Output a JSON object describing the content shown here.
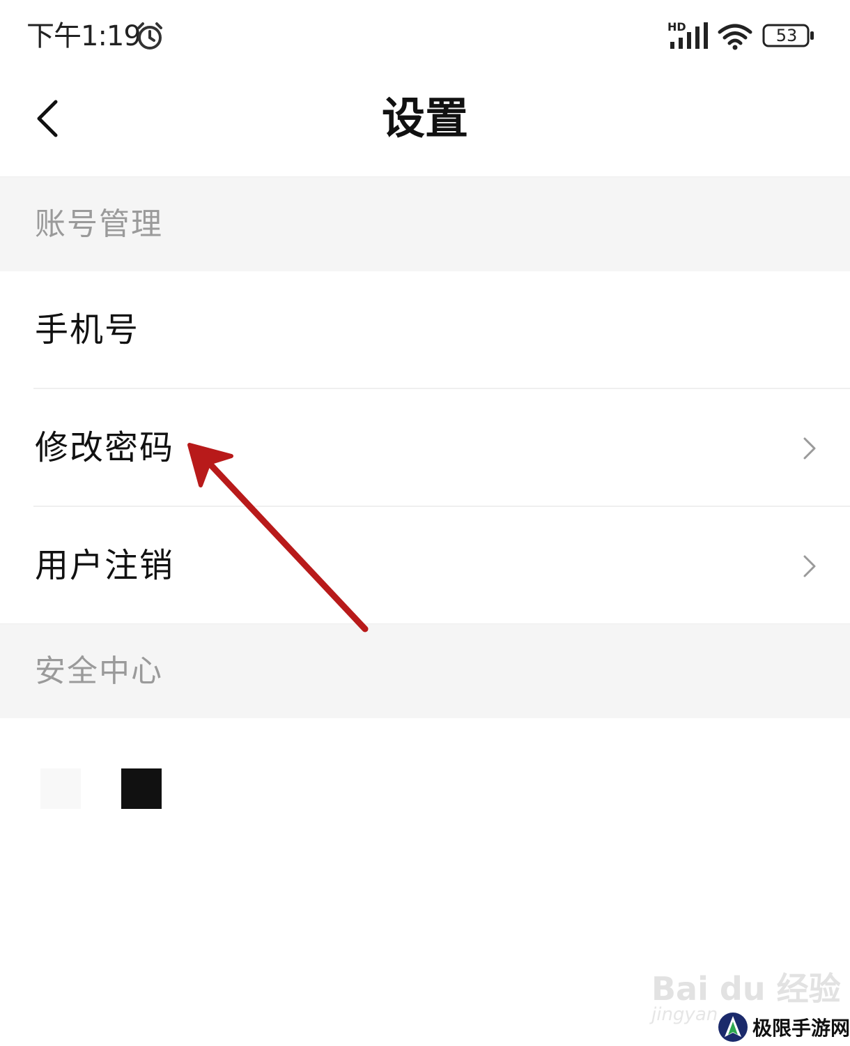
{
  "status_bar": {
    "time": "下午1:19",
    "network": "HD",
    "battery": "53"
  },
  "header": {
    "title": "设置"
  },
  "sections": {
    "account": {
      "title": "账号管理",
      "items": [
        {
          "label": "手机号"
        },
        {
          "label": "修改密码"
        },
        {
          "label": "用户注销"
        }
      ]
    },
    "security": {
      "title": "安全中心"
    }
  },
  "watermark": {
    "baidu": "Bai du 经验",
    "jingyan": "jingyan",
    "site": "极限手游网"
  },
  "colors": {
    "annotation_arrow": "#b81a1a",
    "section_bg": "#f5f5f5",
    "section_text": "#9a9a9a"
  }
}
